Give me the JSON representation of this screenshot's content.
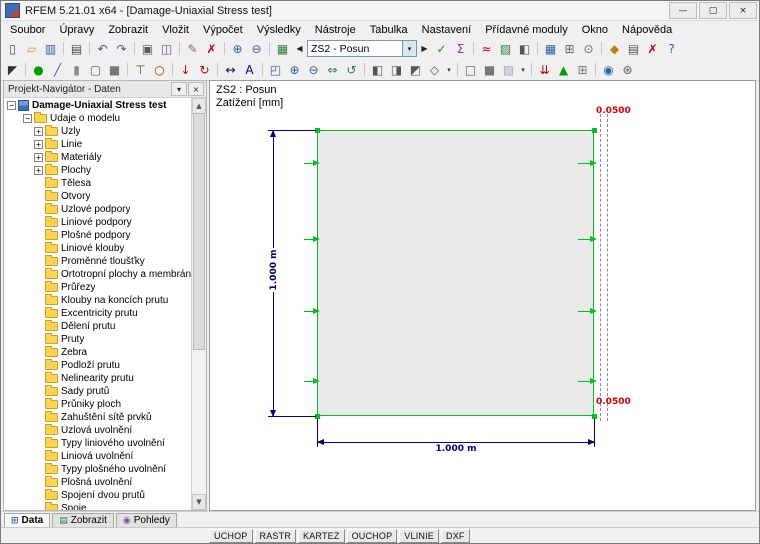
{
  "window": {
    "title": "RFEM 5.21.01 x64 - [Damage-Uniaxial Stress test]",
    "buttons": {
      "minimize": "—",
      "maximize": "▢",
      "close": "×"
    }
  },
  "menu": {
    "items": [
      "Soubor",
      "Úpravy",
      "Zobrazit",
      "Vložit",
      "Výpočet",
      "Výsledky",
      "Nástroje",
      "Tabulka",
      "Nastavení",
      "Přídavné moduly",
      "Okno",
      "Nápověda"
    ]
  },
  "toolbar1": {
    "icons_left": [
      {
        "n": "new-icon",
        "g": "▯",
        "c": "#4a4a4a"
      },
      {
        "n": "open-icon",
        "g": "▱",
        "c": "#c79a2e"
      },
      {
        "n": "save-icon",
        "g": "▥",
        "c": "#2e5fa3"
      },
      {
        "n": "toolbar-separator",
        "t": "sep"
      },
      {
        "n": "print-icon",
        "g": "▤",
        "c": "#4a4a4a"
      },
      {
        "n": "toolbar-separator",
        "t": "sep"
      },
      {
        "n": "undo-icon",
        "g": "↶",
        "c": "#2e5fa3"
      },
      {
        "n": "redo-icon",
        "g": "↷",
        "c": "#2e5fa3"
      },
      {
        "n": "toolbar-separator",
        "t": "sep"
      },
      {
        "n": "copy-icon",
        "g": "▣",
        "c": "#5a5a5a"
      },
      {
        "n": "paste-icon",
        "g": "◫",
        "c": "#7a4fa0"
      },
      {
        "n": "toolbar-separator",
        "t": "sep"
      },
      {
        "n": "edit-icon",
        "g": "✎",
        "c": "#b5651d"
      },
      {
        "n": "delete-icon",
        "g": "✗",
        "c": "#c00000"
      },
      {
        "n": "toolbar-separator",
        "t": "sep"
      },
      {
        "n": "zoom-in-icon",
        "g": "⊕",
        "c": "#2e5fa3"
      },
      {
        "n": "zoom-out-icon",
        "g": "⊖",
        "c": "#2e5fa3"
      },
      {
        "n": "toolbar-separator",
        "t": "sep"
      },
      {
        "n": "loadcase-list-icon",
        "g": "▦",
        "c": "#2e7d32"
      }
    ],
    "loadcase": {
      "prev_glyph": "◀",
      "next_glyph": "▶",
      "dd_glyph": "▾",
      "value": "ZS2 - Posun"
    },
    "icons_right": [
      {
        "n": "check-model-icon",
        "g": "✓",
        "c": "#00a000"
      },
      {
        "n": "calculate-icon",
        "g": "Σ",
        "c": "#7a3fa0"
      },
      {
        "n": "toolbar-separator",
        "t": "sep"
      },
      {
        "n": "show-results-icon",
        "g": "≈",
        "c": "#c00000"
      },
      {
        "n": "result-diagram-icon",
        "g": "▨",
        "c": "#2e7d32"
      },
      {
        "n": "panel-icon",
        "g": "◧",
        "c": "#555555"
      },
      {
        "n": "toolbar-separator",
        "t": "sep"
      },
      {
        "n": "tables-icon",
        "g": "▦",
        "c": "#2e5fa3"
      },
      {
        "n": "grid-icon",
        "g": "⊞",
        "c": "#666666"
      },
      {
        "n": "snap-icon",
        "g": "⊙",
        "c": "#666666"
      },
      {
        "n": "toolbar-separator",
        "t": "sep"
      },
      {
        "n": "modules-icon",
        "g": "◆",
        "c": "#b8860b"
      },
      {
        "n": "project-manager-icon",
        "g": "▤",
        "c": "#555555"
      },
      {
        "n": "stop-icon",
        "g": "✗",
        "c": "#c00000"
      },
      {
        "n": "help-icon",
        "g": "?",
        "c": "#2e5fa3"
      }
    ]
  },
  "toolbar2": {
    "icons": [
      {
        "n": "select-icon",
        "g": "◤",
        "c": "#333333"
      },
      {
        "n": "toolbar-separator",
        "t": "sep"
      },
      {
        "n": "node-icon",
        "g": "●",
        "c": "#00a000"
      },
      {
        "n": "line-icon",
        "g": "╱",
        "c": "#2e5fa3"
      },
      {
        "n": "surface-icon",
        "g": "▮",
        "c": "#8a8a8a"
      },
      {
        "n": "opening-icon",
        "g": "▢",
        "c": "#555555"
      },
      {
        "n": "solid-icon",
        "g": "■",
        "c": "#777777"
      },
      {
        "n": "toolbar-separator",
        "t": "sep"
      },
      {
        "n": "support-icon",
        "g": "⊤",
        "c": "#8b4513"
      },
      {
        "n": "hinge-icon",
        "g": "○",
        "c": "#8b4513"
      },
      {
        "n": "toolbar-separator",
        "t": "sep"
      },
      {
        "n": "nodal-load-icon",
        "g": "↓",
        "c": "#c00000"
      },
      {
        "n": "moment-load-icon",
        "g": "↻",
        "c": "#c00000"
      },
      {
        "n": "toolbar-separator",
        "t": "sep"
      },
      {
        "n": "dimension-icon",
        "g": "↔",
        "c": "#00007f"
      },
      {
        "n": "text-icon",
        "g": "A",
        "c": "#00007f"
      },
      {
        "n": "toolbar-separator",
        "t": "sep"
      },
      {
        "n": "zoom-window-icon",
        "g": "◰",
        "c": "#2e5fa3"
      },
      {
        "n": "zoom-in-view-icon",
        "g": "⊕",
        "c": "#2e5fa3"
      },
      {
        "n": "zoom-out-view-icon",
        "g": "⊖",
        "c": "#2e5fa3"
      },
      {
        "n": "pan-icon",
        "g": "⇔",
        "c": "#2e7d32"
      },
      {
        "n": "rotate-view-icon",
        "g": "↺",
        "c": "#2e7d32"
      },
      {
        "n": "toolbar-separator",
        "t": "sep"
      },
      {
        "n": "view-xy-icon",
        "g": "◧",
        "c": "#555555"
      },
      {
        "n": "view-xz-icon",
        "g": "◨",
        "c": "#555555"
      },
      {
        "n": "view-yz-icon",
        "g": "◩",
        "c": "#555555"
      },
      {
        "n": "isometric-view-icon",
        "g": "◇",
        "c": "#555555"
      },
      {
        "n": "chevron-down-icon",
        "t": "dd",
        "g": "▾"
      },
      {
        "n": "toolbar-separator",
        "t": "sep"
      },
      {
        "n": "wireframe-icon",
        "g": "□",
        "c": "#555555"
      },
      {
        "n": "solid-render-icon",
        "g": "■",
        "c": "#777777"
      },
      {
        "n": "transparent-icon",
        "g": "▨",
        "c": "#9aa7c0"
      },
      {
        "n": "chevron-down-icon",
        "t": "dd",
        "g": "▾"
      },
      {
        "n": "toolbar-separator",
        "t": "sep"
      },
      {
        "n": "show-loads-icon",
        "g": "⇊",
        "c": "#c00000"
      },
      {
        "n": "show-supports-icon",
        "g": "▲",
        "c": "#00a000"
      },
      {
        "n": "show-mesh-icon",
        "g": "⊞",
        "c": "#777777"
      },
      {
        "n": "toolbar-separator",
        "t": "sep"
      },
      {
        "n": "saved-views-icon",
        "g": "◉",
        "c": "#2e5fa3"
      },
      {
        "n": "display-settings-icon",
        "g": "⊛",
        "c": "#555555"
      }
    ]
  },
  "navigator": {
    "title": "Projekt-Navigátor - Daten",
    "pin_glyph": "▾",
    "close_glyph": "×",
    "root": {
      "label": "Damage-Uniaxial Stress test",
      "exp": "−"
    },
    "group": {
      "label": "Údaje o modelu",
      "exp": "−"
    },
    "items": [
      {
        "label": "Uzly",
        "exp": "+"
      },
      {
        "label": "Linie",
        "exp": "+"
      },
      {
        "label": "Materiály",
        "exp": "+"
      },
      {
        "label": "Plochy",
        "exp": "+"
      },
      {
        "label": "Tělesa"
      },
      {
        "label": "Otvory"
      },
      {
        "label": "Uzlové podpory"
      },
      {
        "label": "Liniové podpory"
      },
      {
        "label": "Plošné podpory"
      },
      {
        "label": "Liniové klouby"
      },
      {
        "label": "Proměnné tloušťky"
      },
      {
        "label": "Ortotropní plochy a membrány"
      },
      {
        "label": "Průřezy"
      },
      {
        "label": "Klouby na koncích prutu"
      },
      {
        "label": "Excentricity prutu"
      },
      {
        "label": "Dělení prutu"
      },
      {
        "label": "Pruty"
      },
      {
        "label": "Žebra"
      },
      {
        "label": "Podloží prutu"
      },
      {
        "label": "Nelinearity prutu"
      },
      {
        "label": "Sady prutů"
      },
      {
        "label": "Průniky ploch"
      },
      {
        "label": "Zahuštění sítě prvků"
      },
      {
        "label": "Uzlová uvolnění"
      },
      {
        "label": "Typy liniového uvolnění"
      },
      {
        "label": "Liniová uvolnění"
      },
      {
        "label": "Typy plošného uvolnění"
      },
      {
        "label": "Plošná uvolnění"
      },
      {
        "label": "Spojení dvou prutů"
      },
      {
        "label": "Spoje"
      }
    ],
    "tabs": [
      {
        "label": "Data",
        "g": "⊞",
        "c": "#2e5fa3",
        "t": "active"
      },
      {
        "label": "Zobrazit",
        "g": "▤",
        "c": "#2e7d32"
      },
      {
        "label": "Pohledy",
        "g": "◉",
        "c": "#7a4fa0"
      }
    ],
    "scroll_up_glyph": "▲",
    "scroll_down_glyph": "▼"
  },
  "canvas": {
    "info_line1": "ZS2 : Posun",
    "info_line2": "Zatížení [mm]",
    "dim_height": "1.000 m",
    "dim_width": "1.000 m",
    "load_top": "0.0500",
    "load_bottom": "0.0500",
    "colors": {
      "edge": "#00c020",
      "dimension": "#00007f",
      "load_value": "#d40000",
      "plate_fill": "#eaeaea"
    }
  },
  "statusbar": {
    "buttons": [
      "UCHOP",
      "RASTR",
      "KARTEZ",
      "OUCHOP",
      "VLINIE",
      "DXF"
    ]
  }
}
